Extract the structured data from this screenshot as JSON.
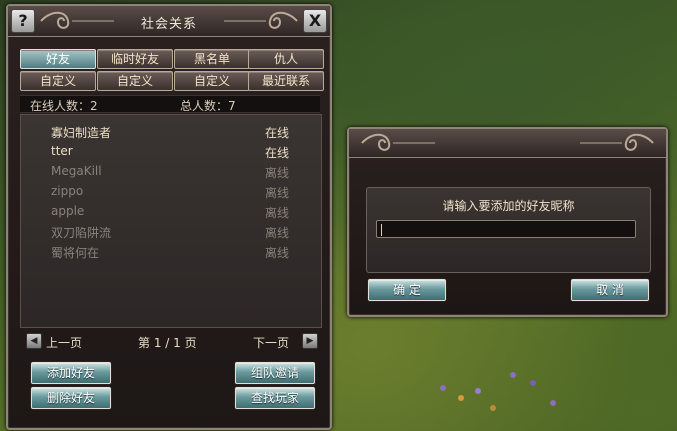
{
  "social": {
    "title": "社会关系",
    "help_label": "?",
    "close_label": "X",
    "tabs_row1": [
      "好友",
      "临时好友",
      "黑名单",
      "仇人"
    ],
    "tabs_row2": [
      "自定义",
      "自定义",
      "自定义",
      "最近联系"
    ],
    "online_count": "在线人数：2",
    "total_count": "总人数：7",
    "friends": [
      {
        "name": "寡妇制造者",
        "status": "在线"
      },
      {
        "name": "tter",
        "status": "在线"
      },
      {
        "name": "MegaKill",
        "status": "离线"
      },
      {
        "name": "zippo",
        "status": "离线"
      },
      {
        "name": "apple",
        "status": "离线"
      },
      {
        "name": "双刀陷阱流",
        "status": "离线"
      },
      {
        "name": "蜀将何在",
        "status": "离线"
      }
    ],
    "pager": {
      "prev": "上一页",
      "page": "第 1 / 1 页",
      "next": "下一页"
    },
    "buttons": {
      "add": "添加好友",
      "delete": "删除好友",
      "invite": "组队邀请",
      "find": "查找玩家"
    }
  },
  "dialog": {
    "prompt": "请输入要添加的好友昵称",
    "input_value": "",
    "confirm": "确 定",
    "cancel": "取 消"
  },
  "colors": {
    "online": "#ecdfc6",
    "offline": "#8a837c",
    "button_teal": "#4f7c82"
  }
}
